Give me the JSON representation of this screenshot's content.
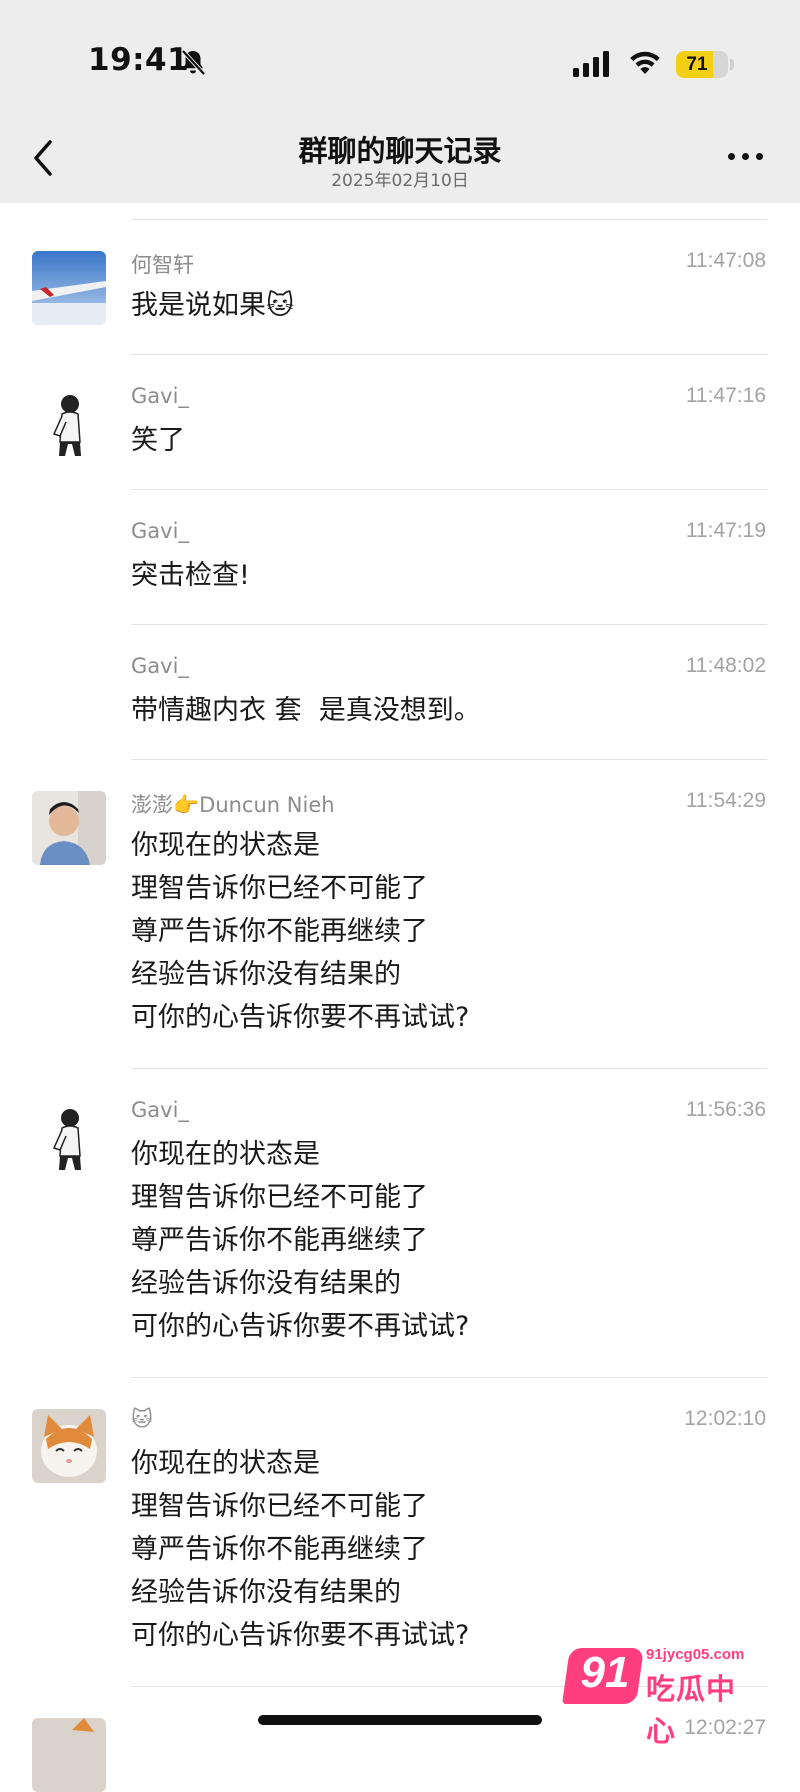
{
  "status_bar": {
    "time": "19:41",
    "battery": "71",
    "battery_level": 0.71
  },
  "header": {
    "title": "群聊的聊天记录",
    "subtitle": "2025年02月10日"
  },
  "messages": [
    {
      "sender": "何智轩",
      "time": "11:47:08",
      "text": "我是说如果🐱"
    },
    {
      "sender": "Gavi_",
      "time": "11:47:16",
      "text": "笑了"
    },
    {
      "sender": "Gavi_",
      "time": "11:47:19",
      "text": "突击检查!"
    },
    {
      "sender": "Gavi_",
      "time": "11:48:02",
      "text": "带情趣内衣 套  是真没想到。"
    },
    {
      "sender": "澎澎👉Duncun Nieh",
      "time": "11:54:29",
      "text": "你现在的状态是\n理智告诉你已经不可能了\n尊严告诉你不能再继续了\n经验告诉你没有结果的\n可你的心告诉你要不再试试?"
    },
    {
      "sender": "Gavi_",
      "time": "11:56:36",
      "text": "你现在的状态是\n理智告诉你已经不可能了\n尊严告诉你不能再继续了\n经验告诉你没有结果的\n可你的心告诉你要不再试试?"
    },
    {
      "sender": "🐱",
      "time": "12:02:10",
      "text": "你现在的状态是\n理智告诉你已经不可能了\n尊严告诉你不能再继续了\n经验告诉你没有结果的\n可你的心告诉你要不再试试?"
    },
    {
      "sender": "",
      "time": "12:02:27",
      "text": ""
    }
  ],
  "watermark": {
    "number": "91",
    "url": "91jycg05.com",
    "name": "吃瓜中心"
  },
  "icons": {
    "back": "chevron-left-icon",
    "more": "ellipsis-icon",
    "silent": "bell-slash-icon",
    "signal": "cellular-signal-icon",
    "wifi": "wifi-icon"
  },
  "colors": {
    "header_bg": "#ededed",
    "battery": "#f3cf16",
    "watermark": "#ff3e7f"
  }
}
